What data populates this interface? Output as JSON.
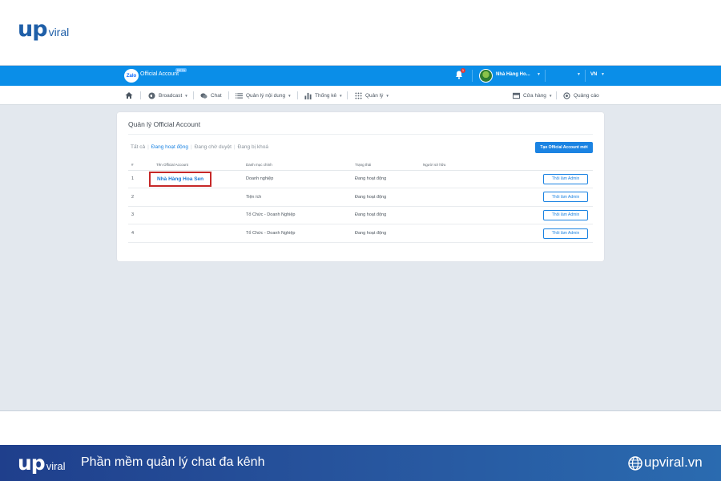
{
  "brand": {
    "up": "up",
    "viral": "viral"
  },
  "zalo": {
    "logo_text": "Zalo",
    "title": "Official Account",
    "beta": "BETA",
    "notification_count": "1",
    "account_name": "Nhà Hàng Ho...",
    "language": "VN"
  },
  "nav": {
    "broadcast": "Broadcast",
    "chat": "Chat",
    "content": "Quản lý nội dung",
    "stats": "Thống kê",
    "manage": "Quản lý",
    "store": "Cửa hàng",
    "ads": "Quảng cáo"
  },
  "page": {
    "title": "Quản lý Official Account",
    "tabs": [
      "Tất cả",
      "Đang hoạt động",
      "Đang chờ duyệt",
      "Đang bị khoá"
    ],
    "create_button": "Tạo Official Account mới"
  },
  "table": {
    "headers": [
      "#",
      "Tên Official Account",
      "Danh mục chính",
      "Trạng thái",
      "Người sở hữu"
    ],
    "rows": [
      {
        "index": "1",
        "name": "Nhà Hàng Hoa Sen",
        "category": "Doanh nghiệp",
        "status": "Đang hoạt động",
        "owner": "",
        "action": "Thôi làm Admin"
      },
      {
        "index": "2",
        "name": "",
        "category": "Tiện ích",
        "status": "Đang hoạt động",
        "owner": "",
        "action": "Thôi làm Admin"
      },
      {
        "index": "3",
        "name": "",
        "category": "Tổ Chức - Doanh Nghiệp",
        "status": "Đang hoạt động",
        "owner": "",
        "action": "Thôi làm Admin"
      },
      {
        "index": "4",
        "name": "",
        "category": "Tổ Chức - Doanh Nghiệp",
        "status": "Đang hoạt động",
        "owner": "",
        "action": "Thôi làm Admin"
      }
    ]
  },
  "banner": {
    "slogan": "Phần mềm quản lý chat đa kênh",
    "site": "upviral.vn"
  },
  "colors": {
    "zalo_blue": "#0a8ee8",
    "link_blue": "#1b83e2",
    "highlight_red": "#c62828",
    "banner_navy": "#1f3f8c"
  }
}
